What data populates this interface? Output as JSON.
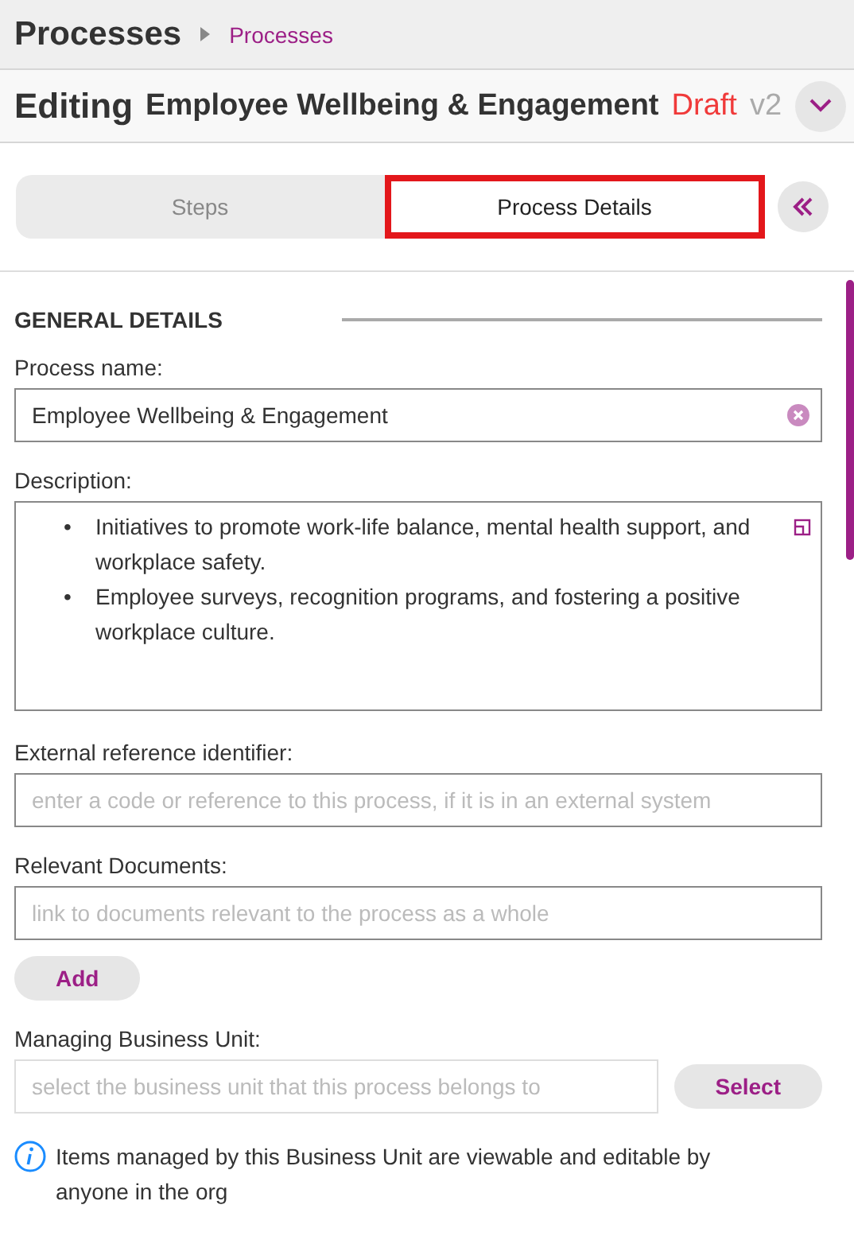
{
  "header": {
    "title": "Processes",
    "breadcrumb": "Processes"
  },
  "editing": {
    "label": "Editing",
    "name": "Employee Wellbeing & Engagement",
    "status": "Draft",
    "version": "v2"
  },
  "tabs": [
    {
      "label": "Steps",
      "selected": false,
      "highlighted": false
    },
    {
      "label": "Process Details",
      "selected": true,
      "highlighted": true
    }
  ],
  "section": {
    "title": "GENERAL DETAILS"
  },
  "fields": [
    {
      "kind": "text",
      "label": "Process name:",
      "value": "Employee Wellbeing & Engagement"
    },
    {
      "kind": "list",
      "label": "Description:",
      "items": [
        {
          "bullet": "•",
          "text": "Initiatives to promote work-life balance, mental health support, and workplace safety."
        },
        {
          "bullet": "•",
          "text": "Employee surveys, recognition programs, and fostering a positive workplace culture."
        }
      ]
    },
    {
      "kind": "text",
      "label": "External reference identifier:",
      "placeholder": "enter a code or reference to this process, if it is in an external system"
    },
    {
      "kind": "add",
      "label": "Relevant Documents:",
      "placeholder": "link to documents relevant to the process as a whole",
      "button": "Add"
    },
    {
      "kind": "select",
      "label": "Managing Business Unit:",
      "placeholder": "select the business unit that this process belongs to",
      "button": "Select"
    }
  ],
  "info": "Items managed by this Business Unit are viewable and editable by anyone in the org"
}
